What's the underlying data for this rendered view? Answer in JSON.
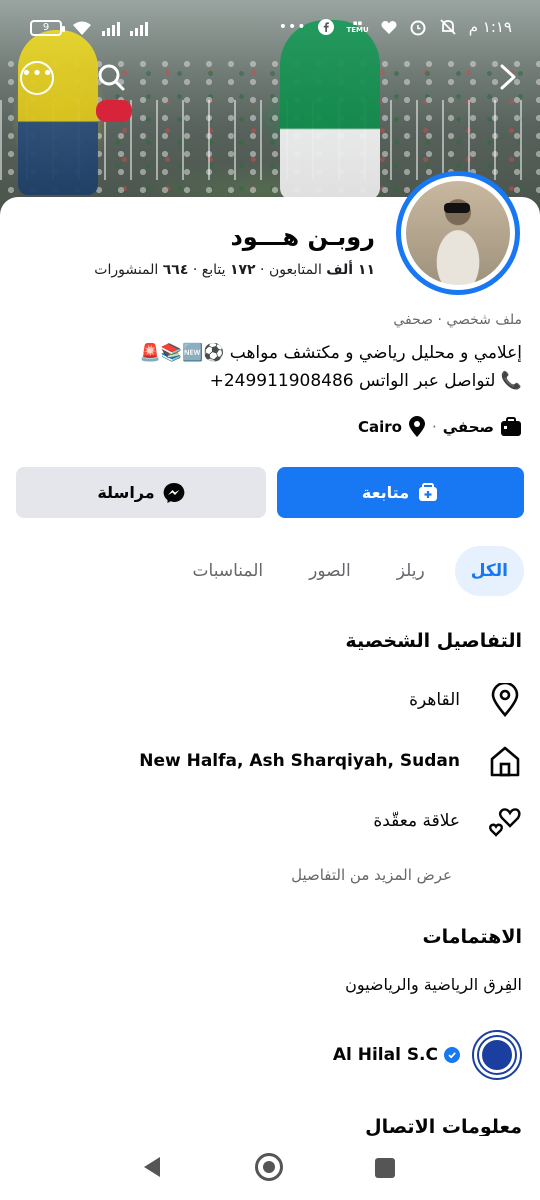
{
  "status_bar": {
    "time": "١:١٩ م",
    "battery": "9",
    "icons": [
      "alarm-off-icon",
      "alarm-icon",
      "heart-icon",
      "temu-icon",
      "facebook-icon",
      "more-dots-icon",
      "signal-icon",
      "signal-icon",
      "wifi-icon",
      "battery-icon"
    ],
    "temu_label": "TEMU"
  },
  "profile": {
    "name": "روبـن هـــود",
    "stats": {
      "followers_count": "١١ ألف",
      "followers_label": "المتابعون",
      "following_count": "١٧٢",
      "following_label": "يتابع",
      "posts_count": "٦٦٤",
      "posts_label": "المنشورات",
      "separator": "·"
    },
    "category": "ملف شخصي · صحفي",
    "bio_line1": "إعلامي و محليل رياضي و مكتشف مواهب ⚽🆕📚🚨",
    "bio_line2": "📞 لتواصل عبر الواتس 249911908486+",
    "meta": {
      "job": "صحفي",
      "location": "Cairo",
      "separator": "·"
    }
  },
  "buttons": {
    "follow_label": "متابعة",
    "message_label": "مراسلة"
  },
  "tabs": [
    {
      "label": "الكل",
      "active": true
    },
    {
      "label": "ريلز",
      "active": false
    },
    {
      "label": "الصور",
      "active": false
    },
    {
      "label": "المناسبات",
      "active": false
    }
  ],
  "personal_details": {
    "title": "التفاصيل الشخصية",
    "current_city": "القاهرة",
    "hometown": "New Halfa, Ash Sharqiyah, Sudan",
    "relationship": "علاقة معقّدة",
    "see_more": "عرض المزيد من التفاصيل"
  },
  "interests": {
    "title": "الاهتمامات",
    "category": "الفِرق الرياضية والرياضيون",
    "page_name": "Al Hilal S.C"
  },
  "contact": {
    "title": "معلومات الاتصال"
  },
  "colors": {
    "accent": "#1877f2",
    "tab_active_bg": "#e7f0fd",
    "secondary_button": "#e4e6eb",
    "muted_text": "#65676b"
  }
}
